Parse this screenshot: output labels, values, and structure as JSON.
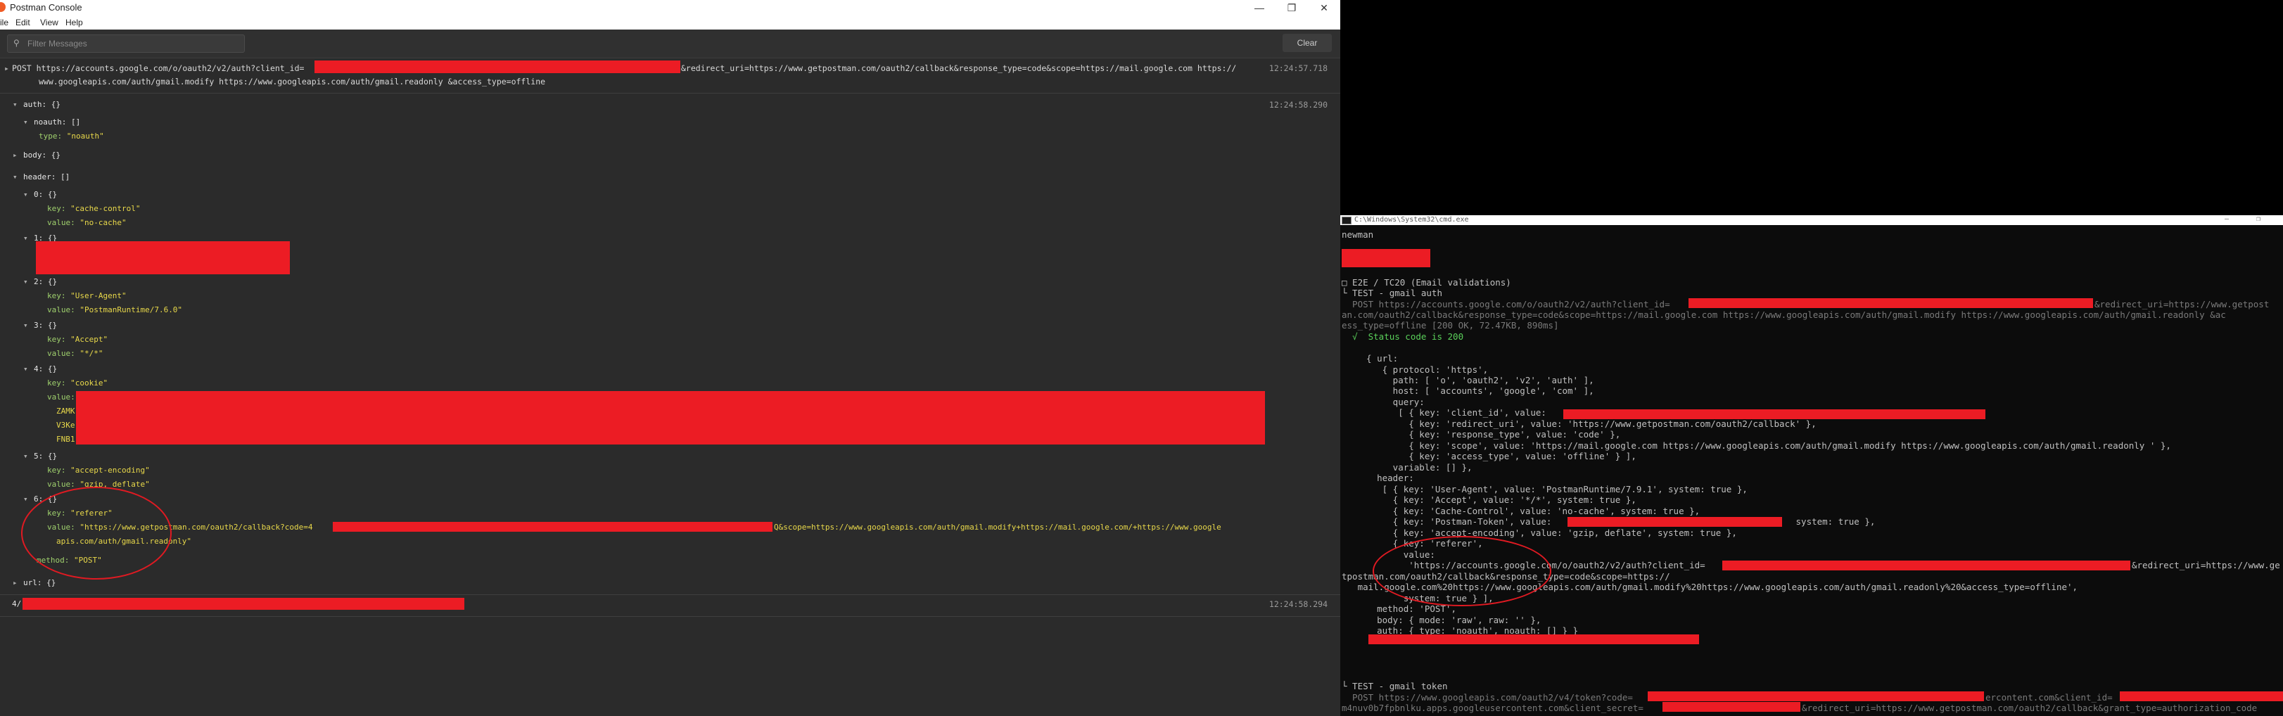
{
  "postman": {
    "title": "Postman Console",
    "menu": [
      "ile",
      "Edit",
      "View",
      "Help"
    ],
    "filter_placeholder": "Filter Messages",
    "clear_label": "Clear",
    "request_line1": "POST https://accounts.google.com/o/oauth2/v2/auth?client_id=",
    "request_line1b": "&redirect_uri=https://www.getpostman.com/oauth2/callback&response_type=code&scope=https://mail.google.com https://",
    "request_line2": "www.googleapis.com/auth/gmail.modify https://www.googleapis.com/auth/gmail.readonly &access_type=offline",
    "ts1": "12:24:57.718",
    "ts2": "12:24:58.290",
    "ts3": "12:24:58.294",
    "tree": {
      "auth": "auth: {}",
      "noauth": "noauth: []",
      "type_key": "type: ",
      "type_val": "\"noauth\"",
      "body": "body: {}",
      "header": "header: []",
      "h0": "0: {}",
      "h0_key": "\"cache-control\"",
      "h0_val": "\"no-cache\"",
      "h1": "1: {}",
      "h2": "2: {}",
      "h2_key": "\"User-Agent\"",
      "h2_val": "\"PostmanRuntime/7.6.0\"",
      "h3": "3: {}",
      "h3_key": "\"Accept\"",
      "h3_val": "\"*/*\"",
      "h4": "4: {}",
      "h4_key": "\"cookie\"",
      "h4_val_label": "value:",
      "h4_frag1": "ZAMK",
      "h4_frag2": "V3Ke",
      "h4_frag3": "FNB1",
      "h5": "5: {}",
      "h5_key": "\"accept-encoding\"",
      "h5_val": "\"gzip, deflate\"",
      "h6": "6: {}",
      "h6_key": "\"referer\"",
      "h6_val1": "\"https://www.getpostman.com/oauth2/callback?code=4",
      "h6_val1b": "Q&scope=https://www.googleapis.com/auth/gmail.modify+https://mail.google.com/+https://www.google",
      "h6_val2": "apis.com/auth/gmail.readonly\"",
      "method_key": "method: ",
      "method_val": "\"POST\"",
      "url": "url: {}",
      "key_label": "key: ",
      "value_label": "value: "
    },
    "last_line_prefix": "4/"
  },
  "cmd": {
    "title": "C:\\Windows\\System32\\cmd.exe",
    "lines": {
      "newman": "newman",
      "suite": "□ E2E / TC20 (Email validations)",
      "test1": "└ TEST - gmail auth",
      "post1a": "  POST https://accounts.google.com/o/oauth2/v2/auth?client_id=",
      "post1b": "&redirect_uri=https://www.getpost",
      "post1c": "an.com/oauth2/callback&response_type=code&scope=https://mail.google.com https://www.googleapis.com/auth/gmail.modify https://www.googleapis.com/auth/gmail.readonly &ac",
      "post1d": "ess_type=offline [200 OK, 72.47KB, 890ms]",
      "status": "  √  Status code is 200",
      "url_open": "  { url:",
      "protocol": "     { protocol: 'https',",
      "path": "       path: [ 'o', 'oauth2', 'v2', 'auth' ],",
      "host": "       host: [ 'accounts', 'google', 'com' ],",
      "query": "       query:",
      "q1": "        [ { key: 'client_id', value: ",
      "q2": "          { key: 'redirect_uri', value: 'https://www.getpostman.com/oauth2/callback' },",
      "q3": "          { key: 'response_type', value: 'code' },",
      "q4": "          { key: 'scope', value: 'https://mail.google.com https://www.googleapis.com/auth/gmail.modify https://www.googleapis.com/auth/gmail.readonly ' },",
      "q5": "          { key: 'access_type', value: 'offline' } ],",
      "variable": "       variable: [] },",
      "header": "    header:",
      "hd1": "     [ { key: 'User-Agent', value: 'PostmanRuntime/7.9.1', system: true },",
      "hd2": "       { key: 'Accept', value: '*/*', system: true },",
      "hd3": "       { key: 'Cache-Control', value: 'no-cache', system: true },",
      "hd4a": "       { key: 'Postman-Token', value: ",
      "hd4b": " system: true },",
      "hd5": "       { key: 'accept-encoding', value: 'gzip, deflate', system: true },",
      "hd6": "       { key: 'referer',",
      "hd7": "         value:",
      "hd8a": "          'https://accounts.google.com/o/oauth2/v2/auth?client_id=",
      "hd8b": "&redirect_uri=https://www.ge",
      "hd9": "tpostman.com/oauth2/callback&response_type=code&scope=https://",
      "hd10": "   mail.google.com%20https://www.googleapis.com/auth/gmail.modify%20https://www.googleapis.com/auth/gmail.readonly%20&access_type=offline',",
      "hd11": "         system: true } ],",
      "method": "    method: 'POST',",
      "body": "    body: { mode: 'raw', raw: '' },",
      "auth": "    auth: { type: 'noauth', noauth: [] } }",
      "test2": "└ TEST - gmail token",
      "post2a": "  POST https://www.googleapis.com/oauth2/v4/token?code=",
      "post2b": "ercontent.com&client_id=",
      "post2c": "m4nuv0b7fpbnlku.apps.googleusercontent.com&client_secret=",
      "post2d": "&redirect_uri=https://www.getpostman.com/oauth2/callback&grant_type=authorization_code"
    }
  }
}
